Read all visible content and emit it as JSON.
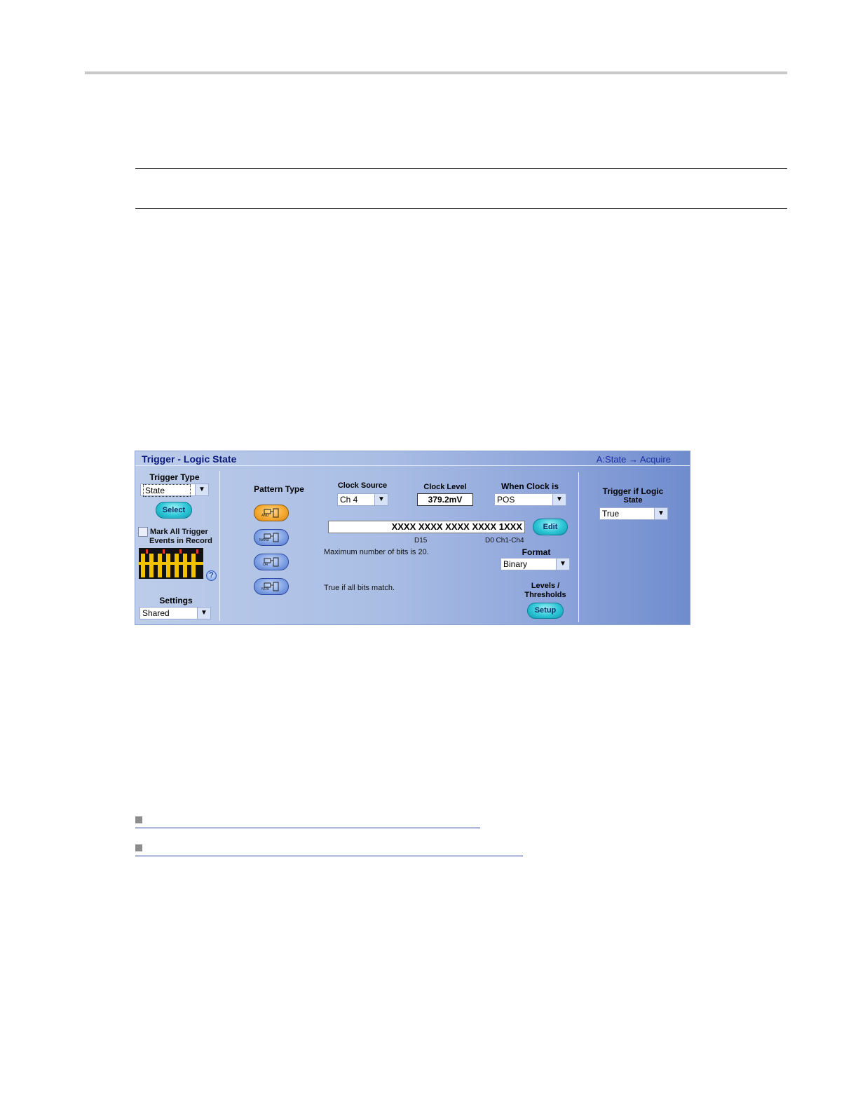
{
  "panel": {
    "title": "Trigger - Logic State",
    "breadcrumb": "A:State → Acquire",
    "trigger_type": {
      "label": "Trigger Type",
      "value": "State",
      "select_label": "Select"
    },
    "mark_events": {
      "label_line1": "Mark All Trigger",
      "label_line2": "Events in Record",
      "checked": false
    },
    "settings": {
      "label": "Settings",
      "value": "Shared"
    },
    "pattern_type": {
      "label": "Pattern Type",
      "gates": [
        "AND",
        "NAND",
        "OR",
        "NOR"
      ],
      "selected": "AND"
    },
    "clock_source": {
      "label": "Clock Source",
      "value": "Ch 4"
    },
    "clock_level": {
      "label": "Clock Level",
      "value": "379.2mV"
    },
    "when_clock": {
      "label": "When Clock is",
      "value": "POS"
    },
    "pattern": {
      "value": "XXXX XXXX XXXX XXXX 1XXX",
      "edit_label": "Edit",
      "msb_label": "D15",
      "lsb_label": "D0 Ch1-Ch4"
    },
    "max_bits_text": "Maximum number of bits is 20.",
    "format": {
      "label": "Format",
      "value": "Binary"
    },
    "condition_text": "True if all bits match.",
    "levels": {
      "label_line1": "Levels /",
      "label_line2": "Thresholds",
      "setup_label": "Setup"
    },
    "trigger_if": {
      "label_line1": "Trigger if Logic",
      "label_line2": "State",
      "value": "True"
    }
  },
  "colors": {
    "title": "#0a1a7a",
    "accent_button": "#2cc6d6",
    "selected_gate": "#f3a62c",
    "waveform": "#f2c200"
  }
}
